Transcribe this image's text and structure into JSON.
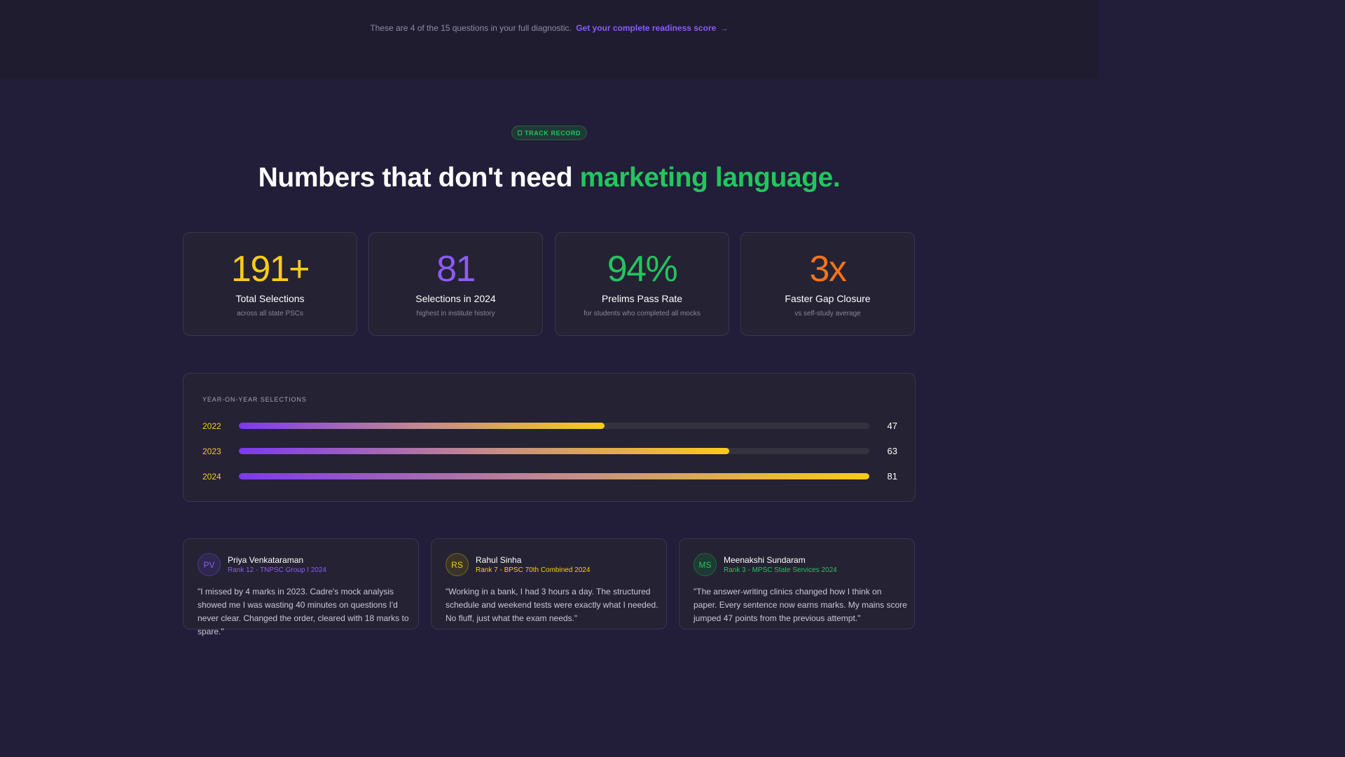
{
  "top_notice": {
    "text": "These are 4 of the 15 questions in your full diagnostic.",
    "cta": "Get your complete readiness score",
    "arrow": "→"
  },
  "badge": {
    "label": "TRACK RECORD",
    "icon": "shield-icon"
  },
  "headline": {
    "plain": "Numbers that don't need",
    "accent": "marketing language."
  },
  "stats": [
    {
      "value": "191+",
      "label": "Total Selections",
      "sub": "across all state PSCs",
      "color": "#facc15"
    },
    {
      "value": "81",
      "label": "Selections in 2024",
      "sub": "highest in institute history",
      "color": "#8b5cf6"
    },
    {
      "value": "94%",
      "label": "Prelims Pass Rate",
      "sub": "for students who completed all mocks",
      "color": "#22c55e"
    },
    {
      "value": "3x",
      "label": "Faster Gap Closure",
      "sub": "vs self-study average",
      "color": "#f97316"
    }
  ],
  "chart_data": {
    "type": "bar",
    "title": "YEAR-ON-YEAR SELECTIONS",
    "categories": [
      "2022",
      "2023",
      "2024"
    ],
    "values": [
      47,
      63,
      81
    ],
    "xlim": [
      0,
      81
    ],
    "orientation": "horizontal",
    "gradient": [
      "#7c3aed",
      "#facc15"
    ]
  },
  "testimonials": [
    {
      "initials": "PV",
      "name": "Priya Venkataraman",
      "rank": "Rank 12 - TNPSC Group I 2024",
      "quote": "\"I missed by 4 marks in 2023. Cadre's mock analysis showed me I was wasting 40 minutes on questions I'd never clear. Changed the order, cleared with 18 marks to spare.\"",
      "color": "#8b5cf6",
      "avatar_bg": "#2e2750"
    },
    {
      "initials": "RS",
      "name": "Rahul Sinha",
      "rank": "Rank 7 - BPSC 70th Combined 2024",
      "quote": "\"Working in a bank, I had 3 hours a day. The structured schedule and weekend tests were exactly what I needed. No fluff, just what the exam needs.\"",
      "color": "#facc15",
      "avatar_bg": "#3a3428"
    },
    {
      "initials": "MS",
      "name": "Meenakshi Sundaram",
      "rank": "Rank 3 - MPSC State Services 2024",
      "quote": "\"The answer-writing clinics changed how I think on paper. Every sentence now earns marks. My mains score jumped 47 points from the previous attempt.\"",
      "color": "#22c55e",
      "avatar_bg": "#1f3a32"
    }
  ]
}
